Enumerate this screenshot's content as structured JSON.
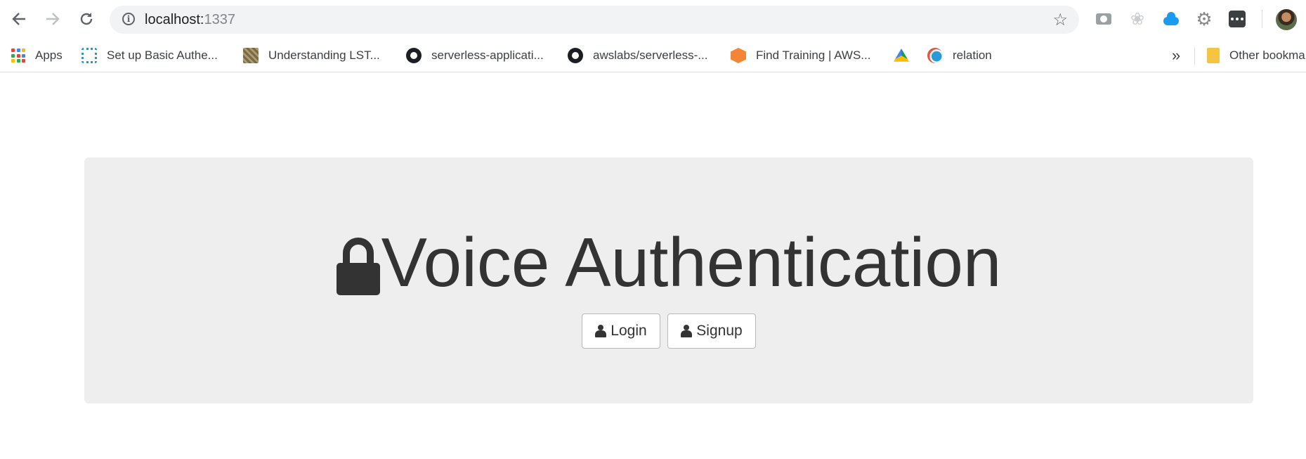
{
  "browser": {
    "url_host": "localhost:",
    "url_port": "1337",
    "icons": {
      "back": "arrow-left-icon",
      "forward": "arrow-right-icon",
      "reload": "reload-icon",
      "info": "info-icon",
      "star": "star-icon"
    },
    "extensions": [
      "camera-icon",
      "flower-icon",
      "cloud-icon",
      "gear-icon",
      "dots-icon"
    ]
  },
  "bookmarks": {
    "items": [
      {
        "label": "Apps",
        "icon": "apps-grid-icon"
      },
      {
        "label": "Set up Basic Authe...",
        "icon": "nodes-icon"
      },
      {
        "label": "Understanding LST...",
        "icon": "lstm-thumbnail-icon"
      },
      {
        "label": "serverless-applicati...",
        "icon": "github-icon"
      },
      {
        "label": "awslabs/serverless-...",
        "icon": "github-icon"
      },
      {
        "label": "Find Training | AWS...",
        "icon": "aws-icon"
      },
      {
        "label": "",
        "icon": "google-drive-icon"
      },
      {
        "label": "relation",
        "icon": "relation-icon"
      }
    ],
    "overflow": "»",
    "other_label": "Other bookma"
  },
  "page": {
    "title": "Voice Authentication",
    "login_label": "Login",
    "signup_label": "Signup"
  },
  "colors": {
    "jumbotron_bg": "#eeeeee",
    "text": "#333333",
    "omnibox_bg": "#f1f3f4"
  }
}
